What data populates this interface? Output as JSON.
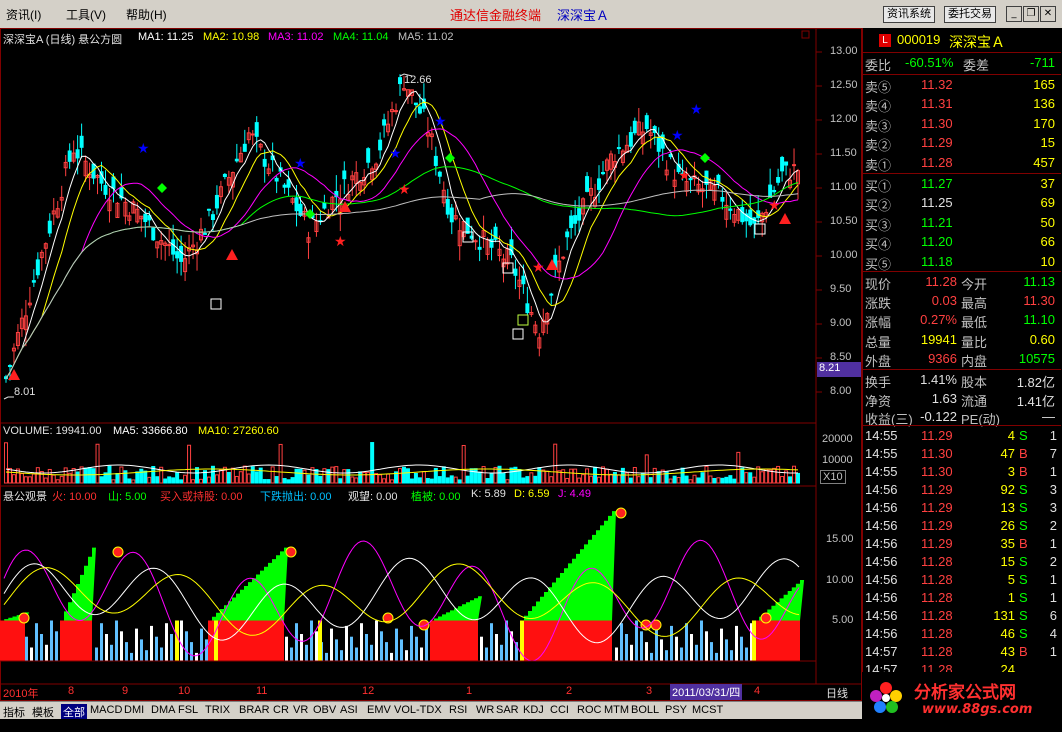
{
  "menubar": {
    "items": [
      "资讯(I)",
      "工具(V)",
      "帮助(H)"
    ],
    "title": "通达信金融终端",
    "stock": "深深宝Ａ",
    "buttons": [
      "资讯系统",
      "委托交易"
    ],
    "window_controls": [
      "minimize-icon",
      "restore-icon",
      "close-icon"
    ]
  },
  "colors": {
    "up": "#ff4040",
    "down": "#00ffff",
    "ma1": "#ffffff",
    "ma2": "#ffff00",
    "ma3": "#ff00ff",
    "ma4": "#00ff00",
    "ma5": "#c0c0c0"
  },
  "price_header": {
    "name": "深深宝A (日线) 悬公方圆",
    "ma1": "MA1: 11.25",
    "ma2": "MA2: 10.98",
    "ma3": "MA3: 11.02",
    "ma4": "MA4: 11.04",
    "ma5": "MA5: 11.02"
  },
  "price_axis": [
    "13.00",
    "12.50",
    "12.00",
    "11.50",
    "11.00",
    "10.50",
    "10.00",
    "9.50",
    "9.00",
    "8.50",
    "8.00"
  ],
  "price_annotations": {
    "high": "12.66",
    "low": "8.01",
    "current_tag": "8.21"
  },
  "volume_header": {
    "label": "VOLUME: 19941.00",
    "ma5": "MA5: 33666.80",
    "ma10": "MA10: 27260.60"
  },
  "volume_axis": [
    "20000",
    "10000",
    "X10"
  ],
  "indicator_header": {
    "name": "悬公观景",
    "items": [
      "火: 10.00",
      "山: 5.00",
      "买入或持股: 0.00",
      "下跌抛出: 0.00",
      "观望: 0.00",
      "植被: 0.00",
      "K: 5.89",
      "D: 6.59",
      "J: 4.49"
    ]
  },
  "indicator_axis": [
    "15.00",
    "10.00",
    "5.00"
  ],
  "date_axis": {
    "year": "2010年",
    "months": [
      "8",
      "9",
      "10",
      "11",
      "12",
      "1",
      "2",
      "3",
      "4"
    ],
    "cursor_date": "2011/03/31/四",
    "period": "日线"
  },
  "tabs": [
    "指标",
    "模板",
    "全部",
    "MACD",
    "DMI",
    "DMA",
    "FSL",
    "TRIX",
    "BRAR",
    "CR",
    "VR",
    "OBV",
    "ASI",
    "EMV",
    "VOL-TDX",
    "RSI",
    "WR",
    "SAR",
    "KDJ",
    "CCI",
    "ROC",
    "MTM",
    "BOLL",
    "PSY",
    "MCST"
  ],
  "quote": {
    "code": "000019",
    "name": "深深宝Ａ",
    "badge": "L",
    "weibi_label": "委比",
    "weibi": "-60.51%",
    "weicha_label": "委差",
    "weicha": "-711",
    "asks": [
      {
        "label": "卖⑤",
        "price": "11.32",
        "vol": "165"
      },
      {
        "label": "卖④",
        "price": "11.31",
        "vol": "136"
      },
      {
        "label": "卖③",
        "price": "11.30",
        "vol": "170"
      },
      {
        "label": "卖②",
        "price": "11.29",
        "vol": "15"
      },
      {
        "label": "卖①",
        "price": "11.28",
        "vol": "457"
      }
    ],
    "bids": [
      {
        "label": "买①",
        "price": "11.27",
        "vol": "37"
      },
      {
        "label": "买②",
        "price": "11.25",
        "vol": "69"
      },
      {
        "label": "买③",
        "price": "11.21",
        "vol": "50"
      },
      {
        "label": "买④",
        "price": "11.20",
        "vol": "66"
      },
      {
        "label": "买⑤",
        "price": "11.18",
        "vol": "10"
      }
    ],
    "stats": [
      {
        "l1": "现价",
        "v1": "11.28",
        "c1": "up",
        "l2": "今开",
        "v2": "11.13",
        "c2": "dn"
      },
      {
        "l1": "涨跌",
        "v1": "0.03",
        "c1": "up",
        "l2": "最高",
        "v2": "11.30",
        "c2": "up"
      },
      {
        "l1": "涨幅",
        "v1": "0.27%",
        "c1": "up",
        "l2": "最低",
        "v2": "11.10",
        "c2": "dn"
      },
      {
        "l1": "总量",
        "v1": "19941",
        "c1": "yel",
        "l2": "量比",
        "v2": "0.60",
        "c2": "yel"
      },
      {
        "l1": "外盘",
        "v1": "9366",
        "c1": "up",
        "l2": "内盘",
        "v2": "10575",
        "c2": "dn"
      }
    ],
    "stats2": [
      {
        "l1": "换手",
        "v1": "1.41%",
        "l2": "股本",
        "v2": "1.82亿"
      },
      {
        "l1": "净资",
        "v1": "1.63",
        "l2": "流通",
        "v2": "1.41亿"
      },
      {
        "l1": "收益(三)",
        "v1": "-0.122",
        "l2": "PE(动)",
        "v2": "—"
      }
    ],
    "ticks": [
      {
        "t": "14:55",
        "p": "11.29",
        "v": "4",
        "s": "S",
        "n": "1"
      },
      {
        "t": "14:55",
        "p": "11.30",
        "v": "47",
        "s": "B",
        "n": "7"
      },
      {
        "t": "14:55",
        "p": "11.30",
        "v": "3",
        "s": "B",
        "n": "1"
      },
      {
        "t": "14:56",
        "p": "11.29",
        "v": "92",
        "s": "S",
        "n": "3"
      },
      {
        "t": "14:56",
        "p": "11.29",
        "v": "13",
        "s": "S",
        "n": "3"
      },
      {
        "t": "14:56",
        "p": "11.29",
        "v": "26",
        "s": "S",
        "n": "2"
      },
      {
        "t": "14:56",
        "p": "11.29",
        "v": "35",
        "s": "B",
        "n": "1"
      },
      {
        "t": "14:56",
        "p": "11.28",
        "v": "15",
        "s": "S",
        "n": "2"
      },
      {
        "t": "14:56",
        "p": "11.28",
        "v": "5",
        "s": "S",
        "n": "1"
      },
      {
        "t": "14:56",
        "p": "11.28",
        "v": "1",
        "s": "S",
        "n": "1"
      },
      {
        "t": "14:56",
        "p": "11.28",
        "v": "131",
        "s": "S",
        "n": "6"
      },
      {
        "t": "14:56",
        "p": "11.28",
        "v": "46",
        "s": "S",
        "n": "4"
      },
      {
        "t": "14:57",
        "p": "11.28",
        "v": "43",
        "s": "B",
        "n": "1"
      },
      {
        "t": "14:57",
        "p": "11.28",
        "v": "24",
        "s": "",
        "n": ""
      }
    ]
  },
  "logo": {
    "text": "分析家公式网",
    "url_text": "www.88gs.com"
  }
}
